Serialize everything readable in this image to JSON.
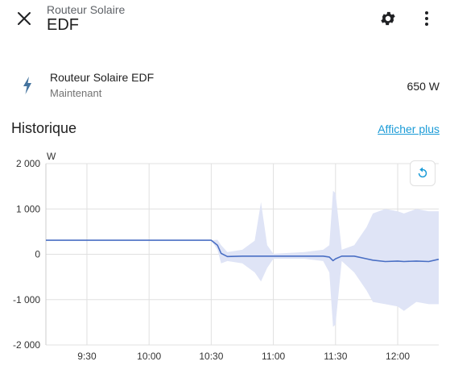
{
  "header": {
    "subtitle": "Routeur Solaire",
    "title": "EDF",
    "close_icon": "close-icon",
    "settings_icon": "gear-icon",
    "more_icon": "more-vertical-icon"
  },
  "entity": {
    "icon": "flash-icon",
    "name": "Routeur Solaire EDF",
    "time": "Maintenant",
    "value": "650 W"
  },
  "history": {
    "title": "Historique",
    "more_link": "Afficher plus",
    "reset_icon": "reset-zoom-icon"
  },
  "colors": {
    "line": "#4a6fc4",
    "band": "#dfe4f6",
    "link": "#1a9bd7"
  },
  "chart_data": {
    "type": "line",
    "ylabel": "W",
    "ylim": [
      -2000,
      2000
    ],
    "yticks": [
      "2 000",
      "1 000",
      "0",
      "-1 000",
      "-2 000"
    ],
    "ytick_values": [
      2000,
      1000,
      0,
      -1000,
      -2000
    ],
    "xticks": [
      "9:30",
      "10:00",
      "10:30",
      "11:00",
      "11:30",
      "12:00"
    ],
    "xtick_values": [
      9.5,
      10.0,
      10.5,
      11.0,
      11.5,
      12.0
    ],
    "xlim": [
      9.17,
      12.33
    ],
    "grid": true,
    "series": [
      {
        "values": [
          {
            "t": 9.17,
            "mean": 310,
            "min": 310,
            "max": 310
          },
          {
            "t": 10.5,
            "mean": 310,
            "min": 310,
            "max": 310
          },
          {
            "t": 10.55,
            "mean": 200,
            "min": 100,
            "max": 320
          },
          {
            "t": 10.58,
            "mean": 20,
            "min": -200,
            "max": 200
          },
          {
            "t": 10.63,
            "mean": -50,
            "min": -150,
            "max": 50
          },
          {
            "t": 10.75,
            "mean": -40,
            "min": -200,
            "max": 100
          },
          {
            "t": 10.85,
            "mean": -40,
            "min": -400,
            "max": 300
          },
          {
            "t": 10.9,
            "mean": -40,
            "min": -600,
            "max": 1150
          },
          {
            "t": 10.95,
            "mean": -40,
            "min": -300,
            "max": 200
          },
          {
            "t": 11.0,
            "mean": -40,
            "min": -100,
            "max": 10
          },
          {
            "t": 11.25,
            "mean": -40,
            "min": -100,
            "max": 50
          },
          {
            "t": 11.4,
            "mean": -40,
            "min": -150,
            "max": 100
          },
          {
            "t": 11.45,
            "mean": -60,
            "min": -400,
            "max": 200
          },
          {
            "t": 11.48,
            "mean": -140,
            "min": -1600,
            "max": 1400
          },
          {
            "t": 11.5,
            "mean": -100,
            "min": -1550,
            "max": 1350
          },
          {
            "t": 11.55,
            "mean": -40,
            "min": -150,
            "max": 100
          },
          {
            "t": 11.65,
            "mean": -40,
            "min": -400,
            "max": 200
          },
          {
            "t": 11.75,
            "mean": -100,
            "min": -800,
            "max": 600
          },
          {
            "t": 11.8,
            "mean": -130,
            "min": -1050,
            "max": 900
          },
          {
            "t": 11.9,
            "mean": -160,
            "min": -1100,
            "max": 1000
          },
          {
            "t": 12.0,
            "mean": -150,
            "min": -1150,
            "max": 950
          },
          {
            "t": 12.05,
            "mean": -160,
            "min": -1250,
            "max": 900
          },
          {
            "t": 12.15,
            "mean": -150,
            "min": -1050,
            "max": 1000
          },
          {
            "t": 12.25,
            "mean": -160,
            "min": -1100,
            "max": 950
          },
          {
            "t": 12.33,
            "mean": -110,
            "min": -1100,
            "max": 950
          }
        ]
      }
    ]
  }
}
